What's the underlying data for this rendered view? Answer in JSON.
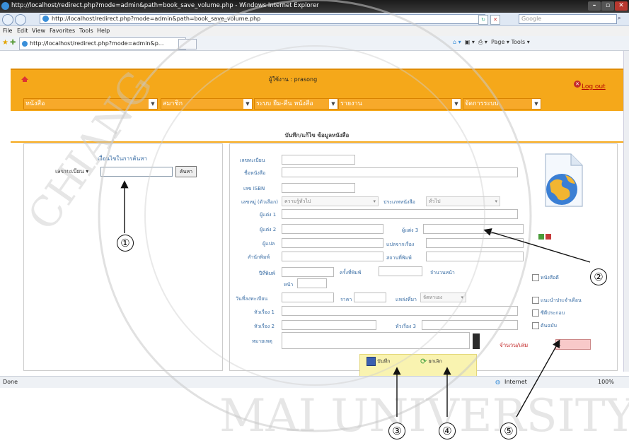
{
  "window": {
    "title": "http://localhost/redirect.php?mode=admin&path=book_save_volume.php - Windows Internet Explorer",
    "address": "http://localhost/redirect.php?mode=admin&path=book_save_volume.php",
    "search_placeholder": "Google",
    "tab_label": "http://localhost/redirect.php?mode=admin&p...",
    "command_bar": "Page ▾  Tools ▾",
    "status_left": "Done",
    "status_zone": "Internet",
    "status_zoom": "100%"
  },
  "menu": [
    "File",
    "Edit",
    "View",
    "Favorites",
    "Tools",
    "Help"
  ],
  "header": {
    "user_label": "ผู้ใช้งาน : prasong",
    "logout": "Log out",
    "nav": [
      "หนังสือ",
      "สมาชิก",
      "ระบบ ยืม-คืน หนังสือ",
      "รายงาน",
      "จัดการระบบ"
    ]
  },
  "page_title": "บันทึก/แก้ไข ข้อมูลหนังสือ",
  "search": {
    "title": "เงื่อนไขในการค้นหา",
    "field": "เลขทะเบียน",
    "button": "ค้นหา"
  },
  "form": {
    "labels": {
      "reg_no": "เลขทะเบียน",
      "title": "ชื่อหนังสือ",
      "isbn": "เลข ISBN",
      "call_no": "เลขหมู่ (ตัวเลือก)",
      "book_type": "ประเภทหนังสือ",
      "author1": "ผู้แต่ง 1",
      "author2": "ผู้แต่ง 2",
      "author3": "ผู้แต่ง 3",
      "translator": "ผู้แปล",
      "subject": "แปลจากเรื่อง",
      "publisher": "สำนักพิมพ์",
      "place": "สถานที่พิมพ์",
      "year": "ปีที่พิมพ์",
      "edition": "ครั้งที่พิมพ์",
      "pages": "จำนวนหน้า",
      "page_unit": "หน้า",
      "reg_date": "วันที่ลงทะเบียน",
      "price": "ราคา",
      "source": "แหล่งที่มา",
      "topic1": "หัวเรื่อง 1",
      "topic2": "หัวเรื่อง 2",
      "topic3": "หัวเรื่อง 3",
      "note": "หมายเหตุ",
      "copies": "จำนวน/เล่ม"
    },
    "selects": {
      "call_no": "ความรู้ทั่วไป",
      "book_type": "ทั่วไป",
      "source": "จัดหาเอง"
    },
    "copies_value": "1",
    "checkboxes": [
      "หนังสือดี",
      "แนะนำประจำเดือน",
      "ซีดีประกอบ",
      "ต้นฉบับ"
    ],
    "save_label": "บันทึก",
    "reset_label": "ยกเลิก"
  },
  "annotations": [
    "①",
    "②",
    "③",
    "④",
    "⑤"
  ]
}
